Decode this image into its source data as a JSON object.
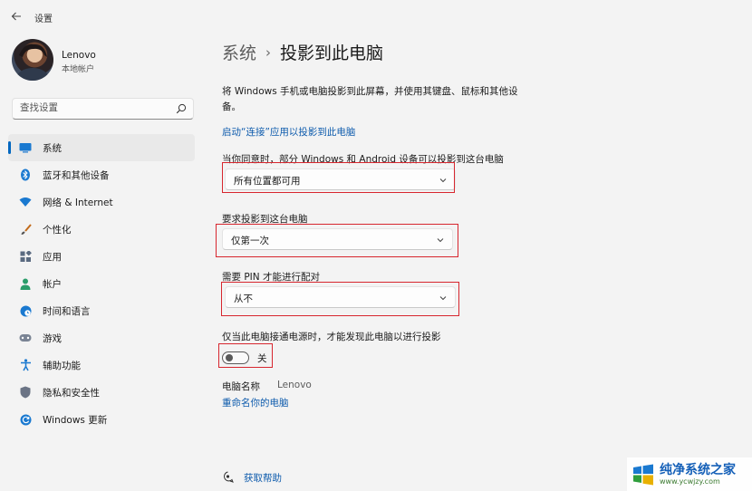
{
  "window": {
    "title": "设置"
  },
  "user": {
    "name": "Lenovo",
    "account_type": "本地帐户"
  },
  "search": {
    "placeholder": "查找设置"
  },
  "sidebar": {
    "items": [
      {
        "label": "系统",
        "icon": "system-icon",
        "active": true
      },
      {
        "label": "蓝牙和其他设备",
        "icon": "bluetooth-icon"
      },
      {
        "label": "网络 & Internet",
        "icon": "wifi-icon"
      },
      {
        "label": "个性化",
        "icon": "brush-icon"
      },
      {
        "label": "应用",
        "icon": "apps-icon"
      },
      {
        "label": "帐户",
        "icon": "person-icon"
      },
      {
        "label": "时间和语言",
        "icon": "globe-clock-icon"
      },
      {
        "label": "游戏",
        "icon": "gamepad-icon"
      },
      {
        "label": "辅助功能",
        "icon": "accessibility-icon"
      },
      {
        "label": "隐私和安全性",
        "icon": "shield-icon"
      },
      {
        "label": "Windows 更新",
        "icon": "update-icon"
      }
    ]
  },
  "page": {
    "breadcrumb_parent": "系统",
    "breadcrumb_separator": "›",
    "title": "投影到此电脑",
    "description": "将 Windows 手机或电脑投影到此屏幕，并使用其键盘、鼠标和其他设备。",
    "connect_link": "启动“连接”应用以投影到此电脑",
    "availability": {
      "label": "当你同意时，部分 Windows 和 Android 设备可以投影到这台电脑",
      "value": "所有位置都可用"
    },
    "ask_to_project": {
      "label": "要求投影到这台电脑",
      "value": "仅第一次"
    },
    "require_pin": {
      "label": "需要 PIN 才能进行配对",
      "value": "从不"
    },
    "power_only": {
      "label": "仅当此电脑接通电源时，才能发现此电脑以进行投影",
      "toggle_state": "关",
      "toggle_on": false
    },
    "pc_name": {
      "label": "电脑名称",
      "value": "Lenovo",
      "rename_link": "重命名你的电脑"
    },
    "help": {
      "label": "获取帮助"
    }
  },
  "watermark": {
    "title": "纯净系统之家",
    "url": "www.ycwjzy.com"
  },
  "colors": {
    "accent": "#0067c0",
    "link": "#0f5cad",
    "highlight": "#d7262e",
    "background": "#f3f3f3"
  }
}
